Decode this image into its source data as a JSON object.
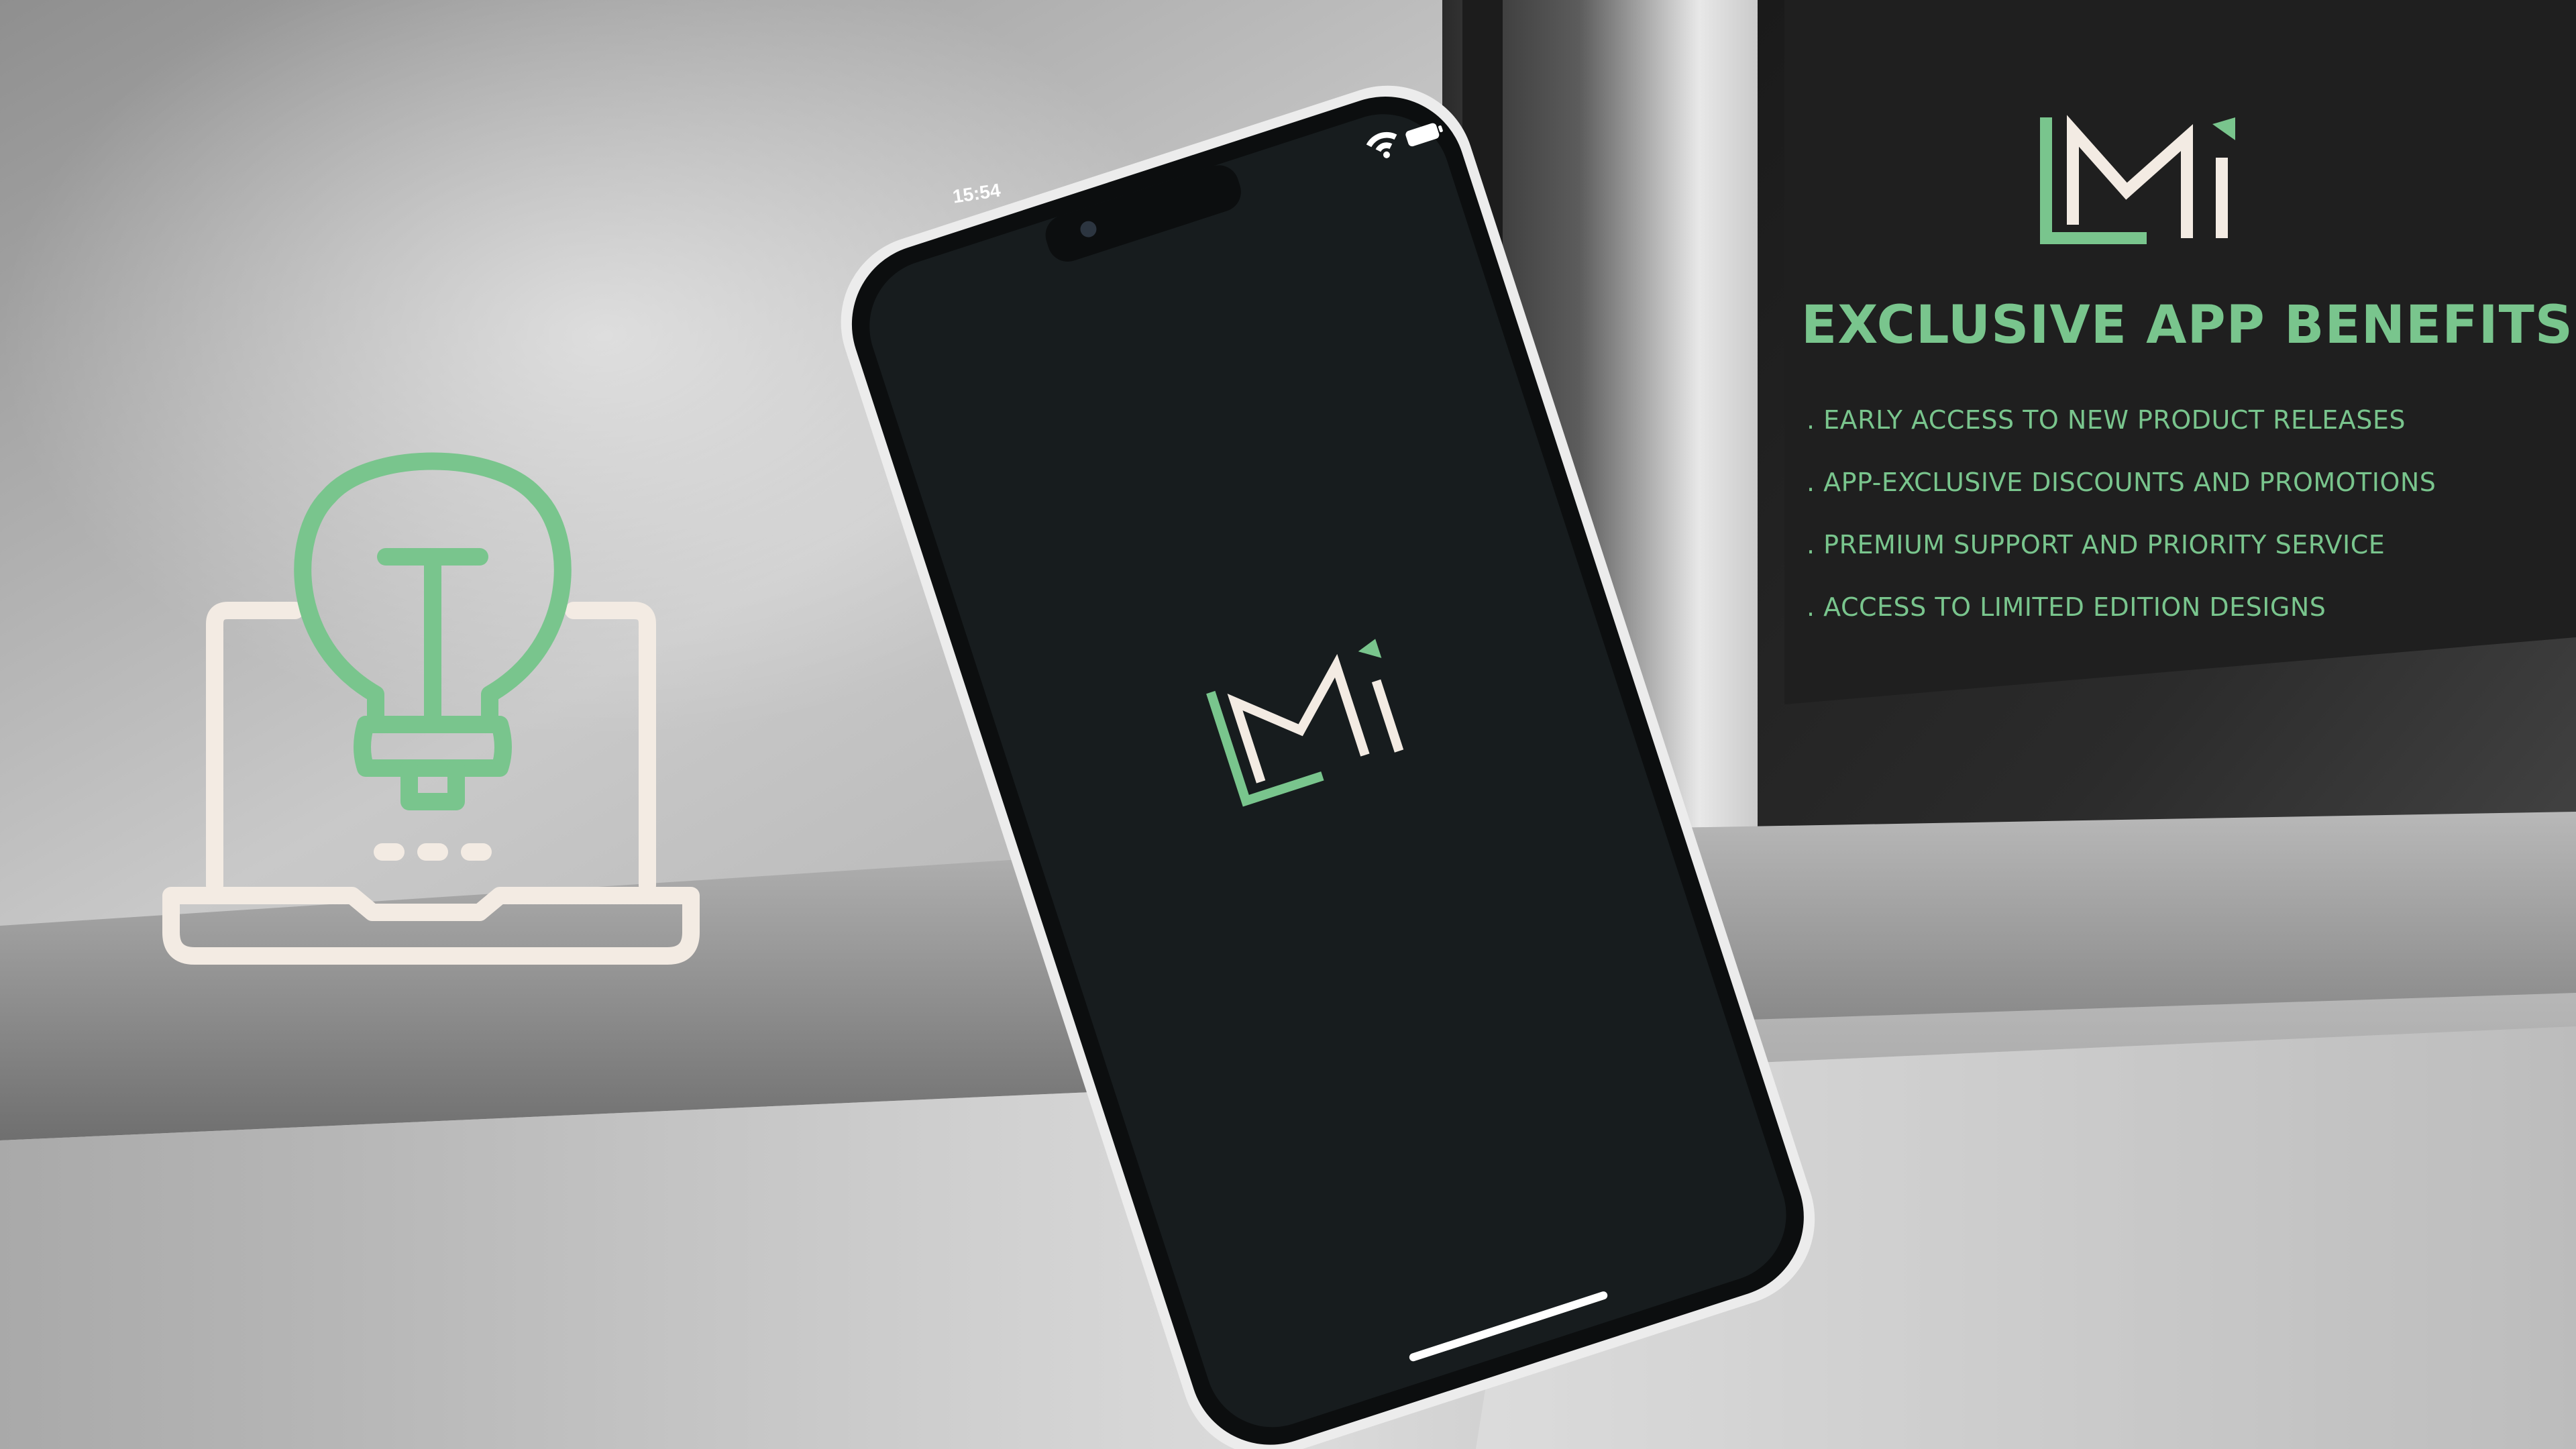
{
  "brand": {
    "logo_text": "LMi"
  },
  "phone": {
    "status_time": "15:54",
    "screen_logo_text": "LMi"
  },
  "benefits": {
    "title": "EXCLUSIVE APP BENEFITS",
    "items": [
      {
        "text": ". EARLY ACCESS TO NEW PRODUCT RELEASES"
      },
      {
        "text": ". APP-EXCLUSIVE DISCOUNTS AND PROMOTIONS"
      },
      {
        "text": ". PREMIUM SUPPORT AND PRIORITY SERVICE"
      },
      {
        "text": ". ACCESS TO LIMITED EDITION DESIGNS"
      }
    ]
  },
  "icons": [
    "idea-laptop-icon",
    "wifi-icon",
    "battery-icon",
    "camera-icon"
  ],
  "colors": {
    "accent_green": "#79c58d",
    "cream": "#f3ebe3",
    "phone_screen": "#171c1e"
  }
}
